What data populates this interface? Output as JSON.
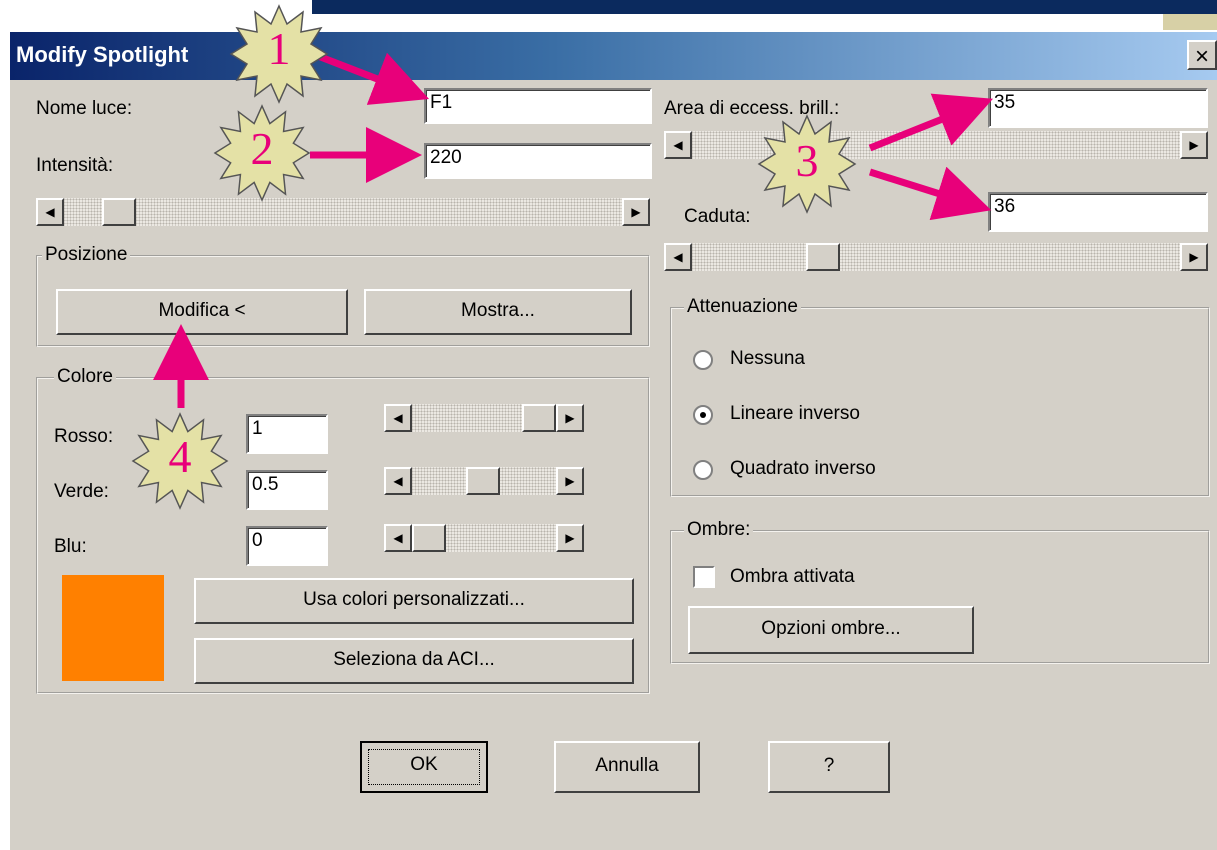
{
  "dialog": {
    "title": "Modify Spotlight",
    "close_label": "×"
  },
  "light": {
    "name_label": "Nome luce:",
    "name_value": "F1",
    "intensity_label": "Intensità:",
    "intensity_value": "220"
  },
  "position_group": {
    "legend": "Posizione",
    "modify_button": "Modifica <",
    "show_button": "Mostra..."
  },
  "color_group": {
    "legend": "Colore",
    "red_label": "Rosso:",
    "red_value": "1",
    "green_label": "Verde:",
    "green_value": "0.5",
    "blue_label": "Blu:",
    "blue_value": "0",
    "swatch_color": "#ff8000",
    "custom_colors_button": "Usa colori personalizzati...",
    "aci_button": "Seleziona da ACI..."
  },
  "hotspot": {
    "label": "Area di eccess. brill.:",
    "value": "35"
  },
  "falloff": {
    "label": "Caduta:",
    "value": "36"
  },
  "attenuation": {
    "legend": "Attenuazione",
    "options": [
      "Nessuna",
      "Lineare inverso",
      "Quadrato inverso"
    ],
    "selected": "Lineare inverso"
  },
  "shadows": {
    "legend": "Ombre:",
    "enabled_label": "Ombra attivata",
    "enabled": false,
    "options_button": "Opzioni ombre..."
  },
  "footer": {
    "ok": "OK",
    "cancel": "Annulla",
    "help": "?"
  },
  "callouts": [
    "1",
    "2",
    "3",
    "4"
  ],
  "callout_color": "#e8007a",
  "scroll_arrows": {
    "left": "◀",
    "right": "▶"
  }
}
